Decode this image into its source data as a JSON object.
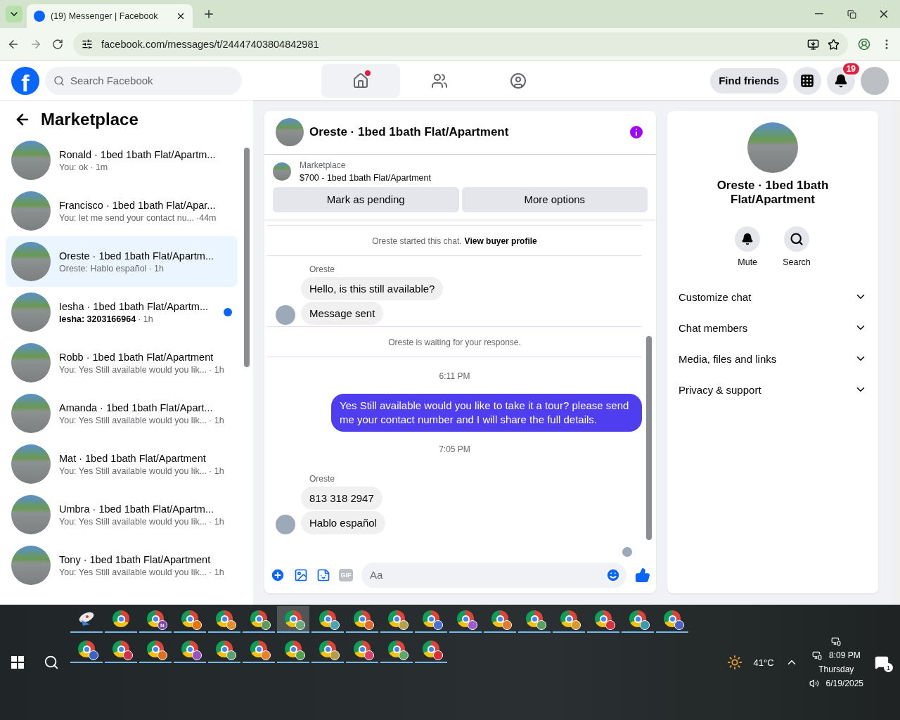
{
  "browser": {
    "tab_title": "(19) Messenger | Facebook",
    "url": "facebook.com/messages/t/24447403804842981"
  },
  "header": {
    "logo_letter": "f",
    "search_placeholder": "Search Facebook",
    "nav_tabs": [
      {
        "kind": "home",
        "selected": true,
        "dot": true
      },
      {
        "kind": "friends",
        "selected": false,
        "dot": false
      },
      {
        "kind": "groups",
        "selected": false,
        "dot": false
      }
    ],
    "find_friends": "Find friends",
    "notification_count": "19"
  },
  "sidebar": {
    "title": "Marketplace",
    "conversations": [
      {
        "title": "Ronald · 1bed 1bath Flat/Apartm...",
        "preview": "You: ok",
        "time": "· 1m",
        "selected": false,
        "unread": false
      },
      {
        "title": "Francisco · 1bed 1bath Flat/Apar...",
        "preview": "You: let me send your contact nu...",
        "time": "·44m",
        "selected": false,
        "unread": false
      },
      {
        "title": "Oreste · 1bed 1bath Flat/Apartm...",
        "preview": "Oreste: Hablo español",
        "time": "· 1h",
        "selected": true,
        "unread": false
      },
      {
        "title": "Iesha · 1bed 1bath Flat/Apartm...",
        "preview": "Iesha: 3203166964",
        "time": "· 1h",
        "selected": false,
        "unread": true
      },
      {
        "title": "Robb · 1bed 1bath Flat/Apartment",
        "preview": "You: Yes Still available would you lik...",
        "time": "· 1h",
        "selected": false,
        "unread": false
      },
      {
        "title": "Amanda · 1bed 1bath Flat/Apart...",
        "preview": "You: Yes Still available would you lik...",
        "time": "· 1h",
        "selected": false,
        "unread": false
      },
      {
        "title": "Mat · 1bed 1bath Flat/Apartment",
        "preview": "You: Yes Still available would you lik...",
        "time": "· 1h",
        "selected": false,
        "unread": false
      },
      {
        "title": "Umbra · 1bed 1bath Flat/Apartm...",
        "preview": "You: Yes Still available would you lik...",
        "time": "· 1h",
        "selected": false,
        "unread": false
      },
      {
        "title": "Tony · 1bed 1bath Flat/Apartment",
        "preview": "You: Yes Still available would you lik...",
        "time": "· 1h",
        "selected": false,
        "unread": false
      }
    ]
  },
  "chat": {
    "title": "Oreste · 1bed 1bath Flat/Apartment",
    "listing": {
      "label": "Marketplace",
      "title": "$700 - 1bed 1bath Flat/Apartment"
    },
    "buttons": [
      "Mark as pending",
      "More options"
    ],
    "messages": [
      {
        "kind": "system",
        "text": "Oreste started this chat.",
        "link": "View buyer profile"
      },
      {
        "kind": "sender",
        "text": "Oreste"
      },
      {
        "kind": "incoming",
        "text": "Hello, is this still available?",
        "avatar": false
      },
      {
        "kind": "incoming",
        "text": "Message sent",
        "avatar": true
      },
      {
        "kind": "system",
        "text": "Oreste is waiting for your response."
      },
      {
        "kind": "timestamp",
        "text": "6:11 PM"
      },
      {
        "kind": "outgoing",
        "text": "Yes Still available would you like to take it a tour? please send me your contact number and I will share the full details."
      },
      {
        "kind": "timestamp",
        "text": "7:05 PM"
      },
      {
        "kind": "sender",
        "text": "Oreste"
      },
      {
        "kind": "incoming",
        "text": "813 318 2947",
        "avatar": false
      },
      {
        "kind": "incoming",
        "text": "Hablo español",
        "avatar": true
      },
      {
        "kind": "seen"
      }
    ],
    "composer": {
      "gif_label": "GIF",
      "placeholder": "Aa"
    }
  },
  "details": {
    "title": "Oreste · 1bed 1bath Flat/Apartment",
    "actions": [
      {
        "kind": "mute",
        "label": "Mute"
      },
      {
        "kind": "search",
        "label": "Search"
      }
    ],
    "sections": [
      {
        "label": "Customize chat",
        "expanded": false
      },
      {
        "label": "Chat members",
        "expanded": false
      },
      {
        "label": "Media, files and links",
        "expanded": false
      },
      {
        "label": "Privacy & support",
        "expanded": false
      }
    ]
  },
  "taskbar": {
    "apps": [
      {
        "kind": "app",
        "selected": false
      },
      {
        "kind": "chrome",
        "selected": false
      },
      {
        "kind": "chrome-letter",
        "letter": "N",
        "color": "#7b3fb5",
        "selected": false
      },
      {
        "kind": "chrome-profile",
        "color": "#e8710a",
        "selected": false
      },
      {
        "kind": "chrome-profile",
        "color": "#e8912a",
        "selected": false
      },
      {
        "kind": "chrome-profile",
        "color": "#5b9a5b",
        "selected": false
      },
      {
        "kind": "chrome-profile",
        "color": "#6aaa7a",
        "selected": true
      },
      {
        "kind": "chrome-profile",
        "color": "#4aa3b5",
        "selected": false
      },
      {
        "kind": "chrome-profile",
        "color": "#e06a2a",
        "selected": false
      },
      {
        "kind": "chrome-profile",
        "color": "#b8a04a",
        "selected": false
      },
      {
        "kind": "chrome-profile",
        "color": "#4a6fd8",
        "selected": false
      },
      {
        "kind": "chrome-profile",
        "color": "#a05ad0",
        "selected": false
      },
      {
        "kind": "chrome-profile",
        "color": "#e07a30",
        "selected": false
      },
      {
        "kind": "chrome-profile",
        "color": "#58a060",
        "selected": false
      },
      {
        "kind": "chrome-profile",
        "color": "#d8982a",
        "selected": false
      },
      {
        "kind": "chrome-profile",
        "color": "#d93040",
        "selected": false
      },
      {
        "kind": "chrome-profile",
        "color": "#3a9ab0",
        "selected": false
      },
      {
        "kind": "chrome-profile",
        "color": "#4a62c8",
        "selected": false
      },
      {
        "kind": "chrome-profile",
        "color": "#3a62c8",
        "selected": false
      },
      {
        "kind": "chrome-profile",
        "color": "#d0304a",
        "selected": false
      },
      {
        "kind": "chrome-profile",
        "color": "#e07020",
        "selected": false
      },
      {
        "kind": "chrome-profile",
        "color": "#9a50c0",
        "selected": false
      },
      {
        "kind": "chrome-profile",
        "color": "#5aa070",
        "selected": false
      },
      {
        "kind": "chrome-profile",
        "color": "#e8802a",
        "selected": false
      },
      {
        "kind": "chrome-profile",
        "color": "#50a050",
        "selected": false
      },
      {
        "kind": "chrome-profile",
        "color": "#b89a40",
        "selected": false
      },
      {
        "kind": "chrome-profile",
        "color": "#d8406a",
        "selected": false
      },
      {
        "kind": "chrome-profile",
        "color": "#60a868",
        "selected": false
      },
      {
        "kind": "chrome-profile",
        "color": "#d83038",
        "selected": false
      }
    ],
    "temperature": "41°C",
    "time": "8:09 PM",
    "day": "Thursday",
    "date": "6/19/2025",
    "notification_count": "1"
  }
}
